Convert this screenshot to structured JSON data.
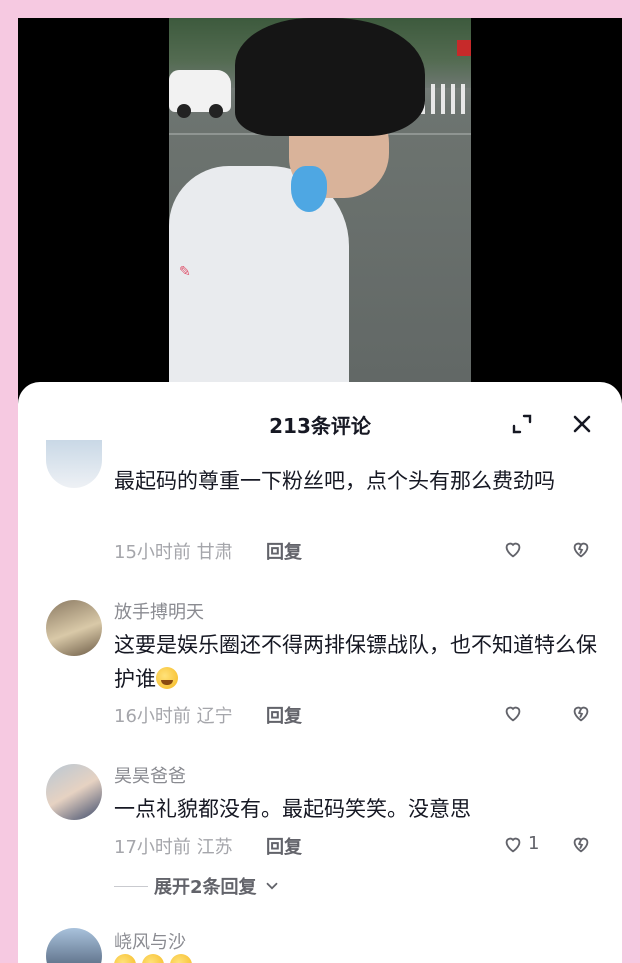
{
  "header": {
    "title": "213条评论"
  },
  "comments": [
    {
      "username": "",
      "text": "最起码的尊重一下粉丝吧，点个头有那么费劲吗",
      "time_location": "15小时前 甘肃",
      "reply_label": "回复",
      "like_count": ""
    },
    {
      "username": "放手搏明天",
      "text": "这要是娱乐圈还不得两排保镖战队，也不知道特么保护谁",
      "time_location": "16小时前 辽宁",
      "reply_label": "回复",
      "like_count": ""
    },
    {
      "username": "昊昊爸爸",
      "text": "一点礼貌都没有。最起码笑笑。没意思",
      "time_location": "17小时前 江苏",
      "reply_label": "回复",
      "like_count": "1"
    },
    {
      "username": "峣风与沙",
      "text": "",
      "time_location": "",
      "reply_label": "",
      "like_count": ""
    }
  ],
  "expand_replies": {
    "label": "展开2条回复"
  },
  "icons": {
    "expand": "expand-icon",
    "close": "close-icon",
    "like": "heart-icon",
    "dislike": "broken-heart-icon",
    "chevron": "chevron-down-icon",
    "emoji": "laughing-crying-emoji"
  },
  "colors": {
    "page_bg": "#f6c9e1",
    "text": "#161823",
    "secondary": "#8a8b91"
  }
}
